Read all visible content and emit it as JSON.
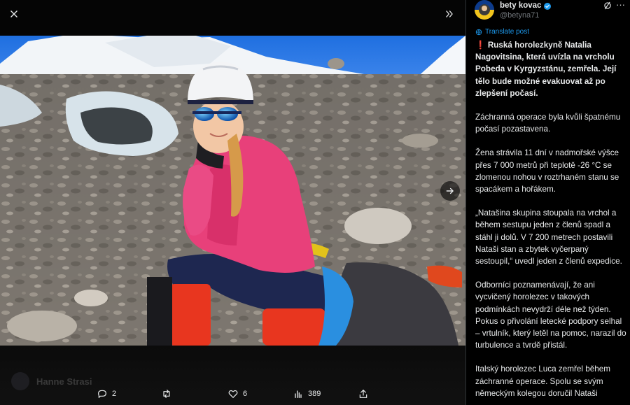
{
  "viewer": {
    "icons": {
      "close": "close-icon",
      "collapse": "chevrons-right-icon",
      "next": "arrow-right-icon"
    },
    "ghost_author_name": "Hanne Strasi",
    "image_subject": "climber in pink jacket, mirrored sunglasses and white helmet on glacier moraine"
  },
  "actions": {
    "replies": "2",
    "reposts": "",
    "likes": "6",
    "views": "389"
  },
  "author": {
    "name": "bety kovac",
    "handle": "@betyna71",
    "verified": true
  },
  "translate_label": "Translate post",
  "post": {
    "alert_icon": "❗",
    "lead": "Ruská horolezkyně Natalia Nagovitsina, která uvízla na vrcholu Pobeda v Kyrgyzstánu, zemřela. Její tělo bude možné evakuovat až po zlepšení počasí.",
    "paragraphs": [
      "Záchranná operace byla kvůli špatnému počasí pozastavena.",
      "Žena strávila 11 dní v nadmořské výšce přes 7 000 metrů při teplotě -26 °C se zlomenou nohou v roztrhaném stanu se spacákem a hořákem.",
      "„Natašina skupina stoupala na vrchol a během sestupu jeden z členů spadl a stáhl ji dolů. V 7 200 metrech postavili Nataši stan a zbytek vyčerpaný sestoupil,“ uvedl jeden z členů expedice.",
      "Odborníci poznamenávají, že ani vycvičený horolezec v takových podmínkách nevydrží déle než týden. Pokus o přivolání letecké podpory selhal – vrtulník, který letěl na pomoc, narazil do turbulence a tvrdě přistál.",
      "Italský horolezec Luca zemřel během záchranné operace. Spolu se svým německým kolegou doručil Nataši"
    ]
  },
  "colors": {
    "link": "#1d9bf0",
    "verified": "#1d9bf0",
    "alert": "#f4212e",
    "jacket": "#e8407a",
    "sky": "#1f6fe0"
  }
}
